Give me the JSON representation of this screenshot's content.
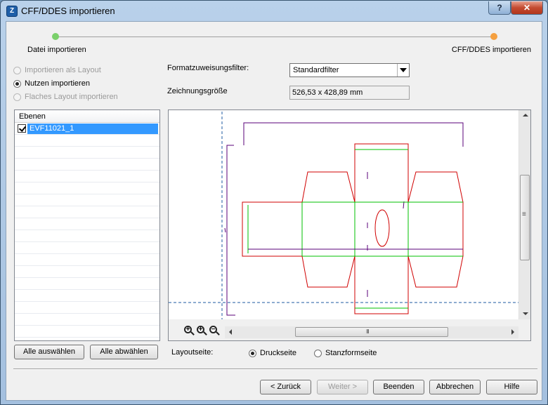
{
  "window": {
    "title": "CFF/DDES importieren",
    "help_label": "?",
    "close_label": "✕"
  },
  "steps": [
    {
      "label": "Datei importieren",
      "color": "#7ad06b"
    },
    {
      "label": "CFF/DDES importieren",
      "color": "#f5a040"
    }
  ],
  "import_mode": {
    "options": [
      {
        "label": "Importieren als Layout",
        "enabled": false,
        "checked": false
      },
      {
        "label": "Nutzen importieren",
        "enabled": true,
        "checked": true
      },
      {
        "label": "Flaches Layout importieren",
        "enabled": false,
        "checked": false
      }
    ]
  },
  "format_filter": {
    "label": "Formatzuweisungsfilter:",
    "value": "Standardfilter"
  },
  "drawing_size": {
    "label": "Zeichnungsgröße",
    "value": "526,53 x 428,89 mm"
  },
  "layers": {
    "header": "Ebenen",
    "items": [
      {
        "name": "EVF11021_1",
        "checked": true
      }
    ]
  },
  "buttons": {
    "select_all": "Alle auswählen",
    "deselect_all": "Alle abwählen",
    "back": "< Zurück",
    "next": "Weiter >",
    "finish": "Beenden",
    "cancel": "Abbrechen",
    "help": "Hilfe"
  },
  "layout_side": {
    "label": "Layoutseite:",
    "options": [
      {
        "label": "Druckseite",
        "checked": true
      },
      {
        "label": "Stanzformseite",
        "checked": false
      }
    ]
  },
  "preview": {
    "scroll_thumb_label": "III",
    "colors": {
      "cut": "#d00000",
      "crease": "#00c000",
      "bleed": "#5a007a",
      "guide": "#1e5aa0"
    }
  }
}
